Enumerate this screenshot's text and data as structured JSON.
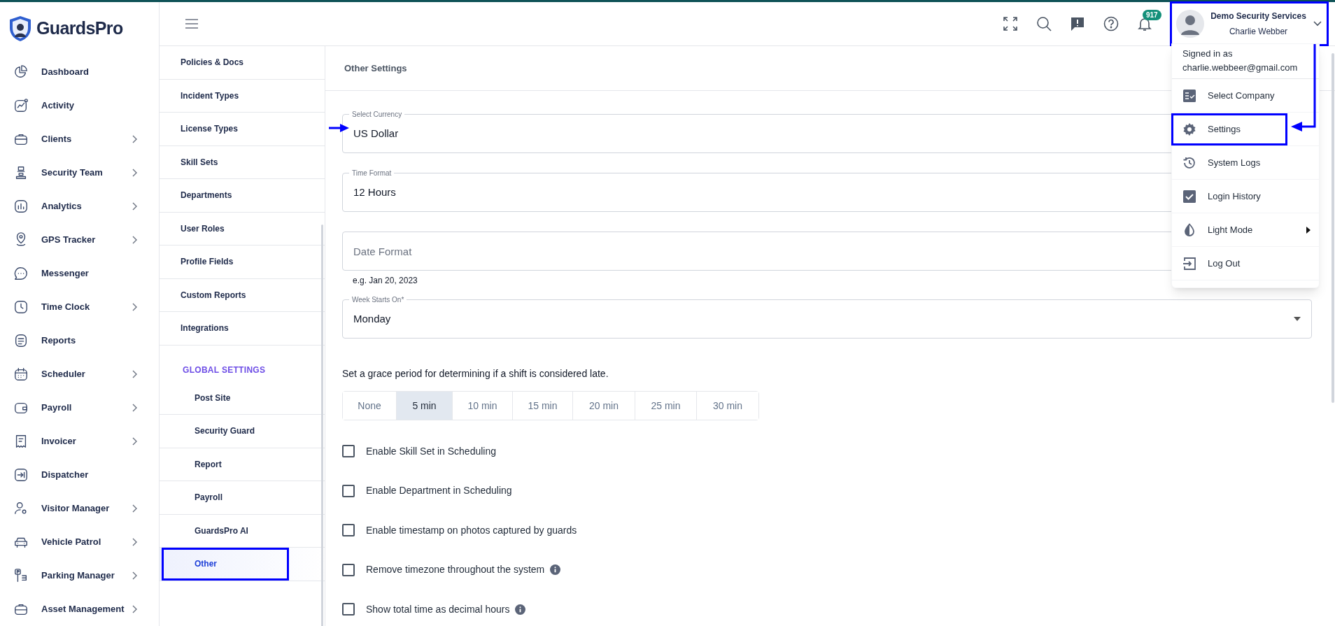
{
  "brand": {
    "name": "GuardsPro"
  },
  "sidebar": {
    "items": [
      {
        "label": "Dashboard",
        "expandable": false
      },
      {
        "label": "Activity",
        "expandable": false
      },
      {
        "label": "Clients",
        "expandable": true
      },
      {
        "label": "Security Team",
        "expandable": true
      },
      {
        "label": "Analytics",
        "expandable": true
      },
      {
        "label": "GPS Tracker",
        "expandable": true
      },
      {
        "label": "Messenger",
        "expandable": false
      },
      {
        "label": "Time Clock",
        "expandable": true
      },
      {
        "label": "Reports",
        "expandable": false
      },
      {
        "label": "Scheduler",
        "expandable": true
      },
      {
        "label": "Payroll",
        "expandable": true
      },
      {
        "label": "Invoicer",
        "expandable": true
      },
      {
        "label": "Dispatcher",
        "expandable": false
      },
      {
        "label": "Visitor Manager",
        "expandable": true
      },
      {
        "label": "Vehicle Patrol",
        "expandable": true
      },
      {
        "label": "Parking Manager",
        "expandable": true
      },
      {
        "label": "Asset Management",
        "expandable": true
      }
    ]
  },
  "header": {
    "notification_count": "917",
    "profile": {
      "company": "Demo Security Services",
      "user": "Charlie Webber",
      "highlighted": true
    }
  },
  "user_menu": {
    "signed_in_label": "Signed in as",
    "email": "charlie.webbeer@gmail.com",
    "items": [
      {
        "label": "Select Company",
        "submenu": false,
        "highlighted": false
      },
      {
        "label": "Settings",
        "submenu": false,
        "highlighted": true
      },
      {
        "label": "System Logs",
        "submenu": false,
        "highlighted": false
      },
      {
        "label": "Login History",
        "submenu": false,
        "highlighted": false
      },
      {
        "label": "Light Mode",
        "submenu": true,
        "highlighted": false
      },
      {
        "label": "Log Out",
        "submenu": false,
        "highlighted": false
      }
    ]
  },
  "settings_nav": {
    "items": [
      {
        "label": "Policies & Docs",
        "selected": false
      },
      {
        "label": "Incident Types",
        "selected": false
      },
      {
        "label": "License Types",
        "selected": false
      },
      {
        "label": "Skill Sets",
        "selected": false
      },
      {
        "label": "Departments",
        "selected": false
      },
      {
        "label": "User Roles",
        "selected": false
      },
      {
        "label": "Profile Fields",
        "selected": false
      },
      {
        "label": "Custom Reports",
        "selected": false
      },
      {
        "label": "Integrations",
        "selected": false
      }
    ],
    "group_title": "GLOBAL SETTINGS",
    "group_items": [
      {
        "label": "Post Site",
        "selected": false
      },
      {
        "label": "Security Guard",
        "selected": false
      },
      {
        "label": "Report",
        "selected": false
      },
      {
        "label": "Payroll",
        "selected": false
      },
      {
        "label": "GuardsPro AI",
        "selected": false
      },
      {
        "label": "Other",
        "selected": true
      }
    ]
  },
  "panel": {
    "title": "Other Settings",
    "fields": [
      {
        "kind": "text",
        "label": "Select Currency",
        "value": "US Dollar"
      },
      {
        "kind": "text",
        "label": "Time Format",
        "value": "12 Hours"
      },
      {
        "kind": "empty",
        "placeholder": "Date Format",
        "hint": "e.g. Jan 20, 2023"
      },
      {
        "kind": "select",
        "label": "Week Starts On*",
        "value": "Monday"
      }
    ],
    "grace_prompt": "Set a grace period for determining if a shift is considered late.",
    "grace_options": [
      {
        "label": "None",
        "selected": false
      },
      {
        "label": "5 min",
        "selected": true
      },
      {
        "label": "10 min",
        "selected": false
      },
      {
        "label": "15 min",
        "selected": false
      },
      {
        "label": "20 min",
        "selected": false
      },
      {
        "label": "25 min",
        "selected": false
      },
      {
        "label": "30 min",
        "selected": false
      }
    ],
    "checkboxes": [
      {
        "label": "Enable Skill Set in Scheduling",
        "checked": false,
        "info": false
      },
      {
        "label": "Enable Department in Scheduling",
        "checked": false,
        "info": false
      },
      {
        "label": "Enable timestamp on photos captured by guards",
        "checked": false,
        "info": false
      },
      {
        "label": "Remove timezone throughout the system",
        "checked": false,
        "info": true
      },
      {
        "label": "Show total time as decimal hours",
        "checked": false,
        "info": true
      }
    ]
  }
}
